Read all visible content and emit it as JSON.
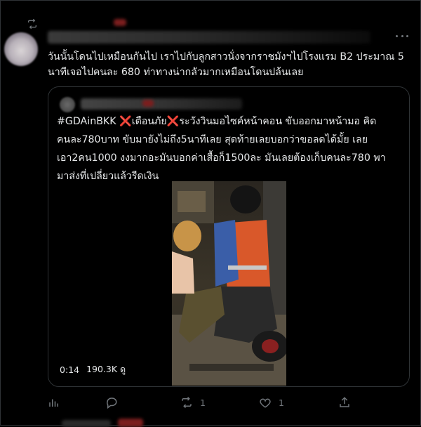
{
  "tweet": {
    "text_lines": [
      "วันนั้นโดนไปเหมือนกันไป เราไปกับลูกสาวนั่งจากราชมังฯไปโรงแรม B2 ประมาณ 5",
      "นาทีเจอไปคนละ 680 ท่าทางน่ากลัวมากเหมือนโดนปล้นเลย"
    ]
  },
  "quote": {
    "hashtag": "#GDAinBKK",
    "warning": "เตือนภัย",
    "mark": "❌",
    "lines": [
      "ระวังวินมอไซค์หน้าคอน ขับออกมาหน้ามอ คิด",
      "คนละ780บาท ขับมายังไม่ถึง5นาทีเลย สุดท้ายเลยบอกว่าขอลดได้มั้ย เลย",
      "เอา2คน1000 งงมากอะมันบอกค่าเสื้อก็1500ละ มันเลยต้องเก็บคนละ780 พา",
      "มาส่งที่เปลี่ยวแล้วรีดเงิน"
    ],
    "video": {
      "duration": "0:14",
      "views": "190.3K ดู"
    }
  },
  "actions": {
    "reply_count": "",
    "retweet_count": "1",
    "like_count": "1"
  },
  "icons": [
    "retweet-icon",
    "more-icon",
    "analytics-icon",
    "reply-icon",
    "like-icon",
    "share-icon"
  ],
  "colors": {
    "background": "#000000",
    "text": "#e7e9ea",
    "muted": "#71767b",
    "border": "#2f3336",
    "red_x": "#e0245e"
  }
}
